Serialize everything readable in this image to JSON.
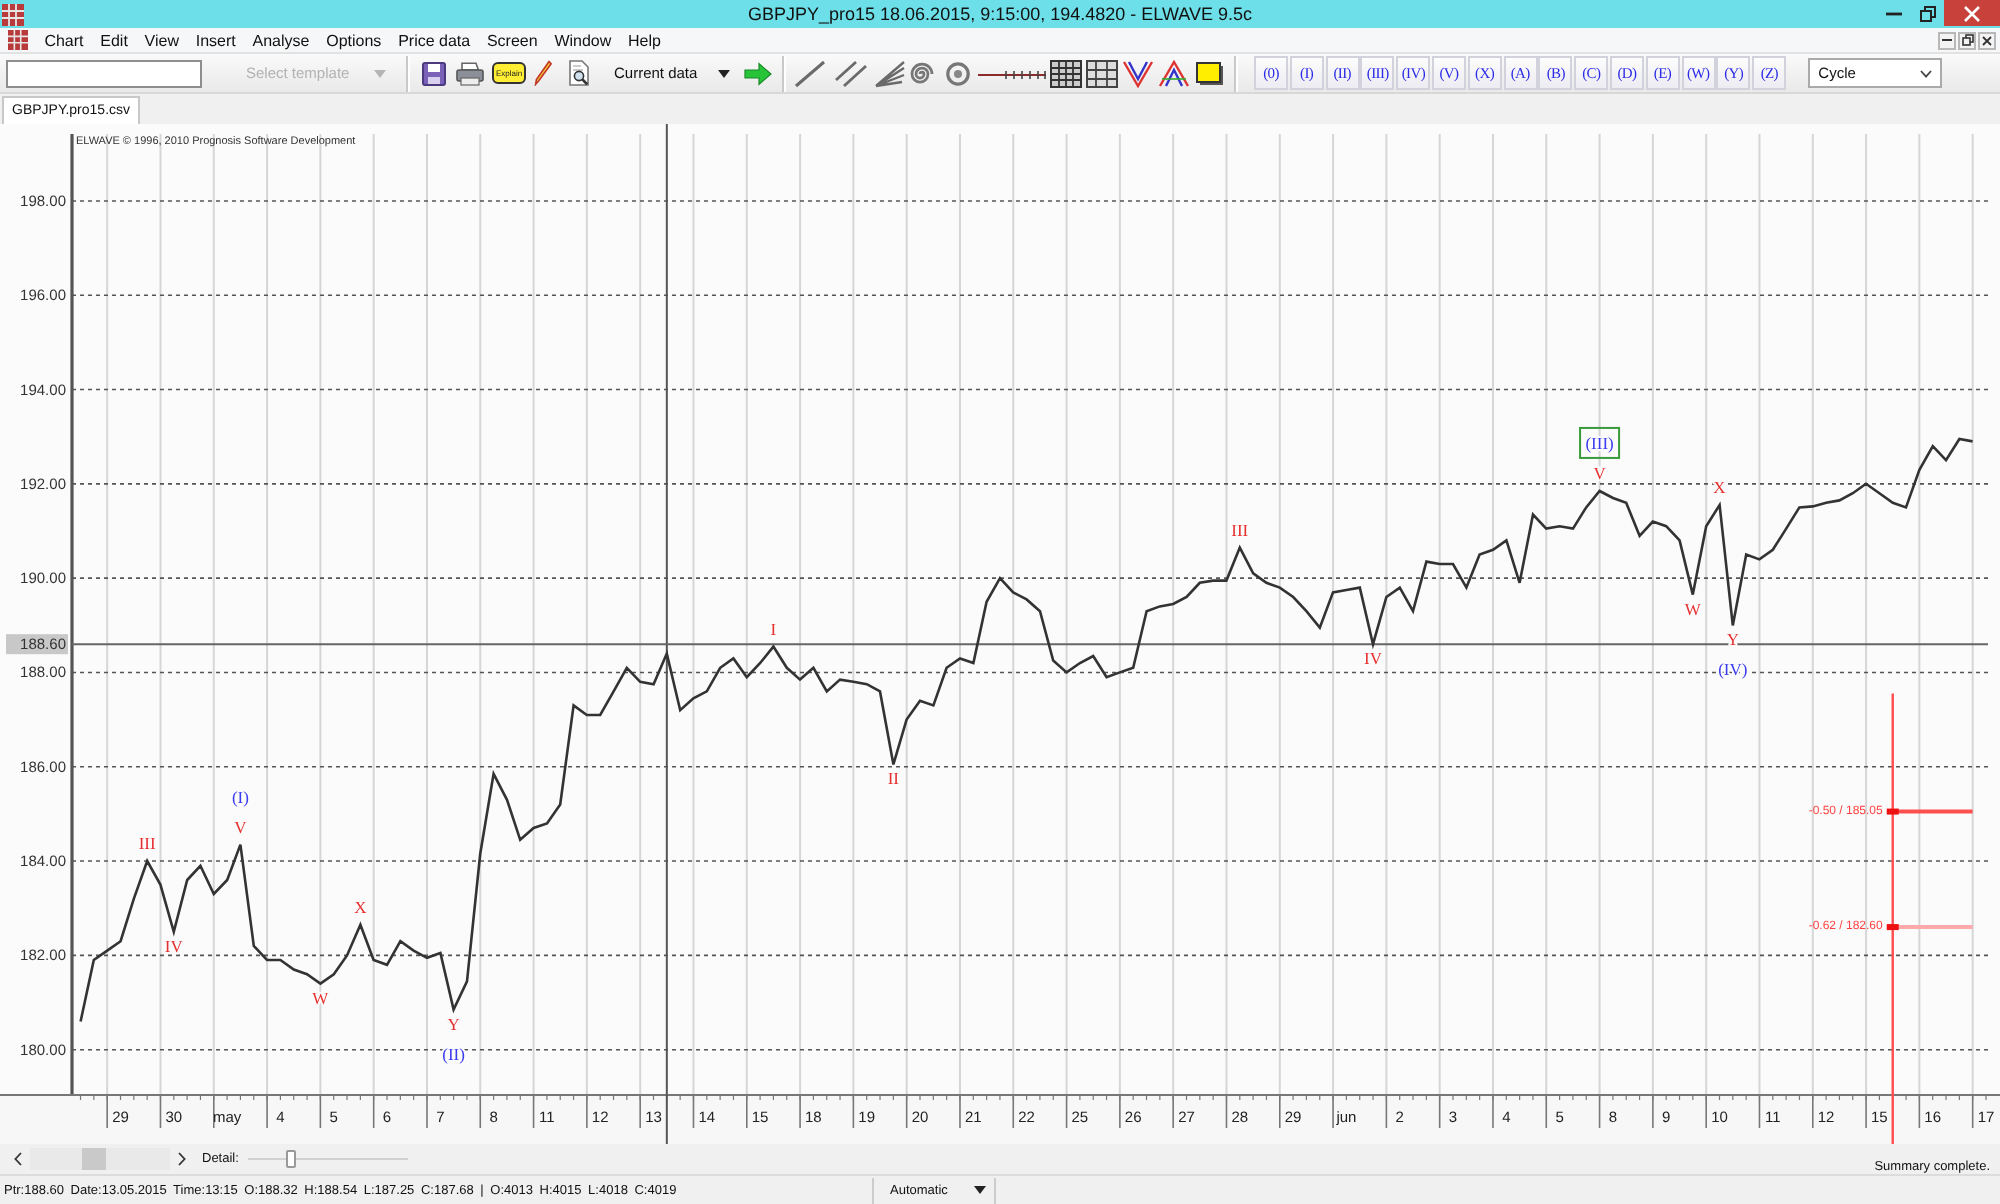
{
  "window": {
    "title": "GBPJPY_pro15 18.06.2015, 9:15:00, 194.4820 - ELWAVE 9.5c"
  },
  "menu": {
    "items": [
      "Chart",
      "Edit",
      "View",
      "Insert",
      "Analyse",
      "Options",
      "Price data",
      "Screen",
      "Window",
      "Help"
    ]
  },
  "toolbar": {
    "template_select": {
      "label": "Select template",
      "disabled": true
    },
    "explain_button": {
      "label": "Explain"
    },
    "data_select": {
      "value": "Current data"
    },
    "wave_buttons": [
      "(0)",
      "(I)",
      "(II)",
      "(III)",
      "(IV)",
      "(V)",
      "(X)",
      "(A)",
      "(B)",
      "(C)",
      "(D)",
      "(E)",
      "(W)",
      "(Y)",
      "(Z)"
    ],
    "degree_select": {
      "value": "Cycle"
    }
  },
  "tabs": [
    {
      "label": "GBPJPY.pro15.csv",
      "selected": true
    }
  ],
  "chart": {
    "copyright": "ELWAVE © 1996, 2010 Prognosis Software Development",
    "chart_data": {
      "type": "line",
      "grid": true,
      "categories": [
        null,
        null,
        null,
        "29",
        null,
        null,
        null,
        "30",
        null,
        null,
        null,
        "may",
        null,
        null,
        null,
        "4",
        null,
        null,
        null,
        "5",
        null,
        null,
        null,
        "6",
        null,
        null,
        null,
        "7",
        null,
        null,
        null,
        "8",
        null,
        null,
        null,
        "11",
        null,
        null,
        null,
        "12",
        null,
        null,
        null,
        "13",
        null,
        null,
        null,
        "14",
        null,
        null,
        null,
        "15",
        null,
        null,
        null,
        "18",
        null,
        null,
        null,
        "19",
        null,
        null,
        null,
        "20",
        null,
        null,
        null,
        "21",
        null,
        null,
        null,
        "22",
        null,
        null,
        null,
        "25",
        null,
        null,
        null,
        "26",
        null,
        null,
        null,
        "27",
        null,
        null,
        null,
        "28",
        null,
        null,
        null,
        "29",
        null,
        null,
        null,
        "jun",
        null,
        null,
        null,
        "2",
        null,
        null,
        null,
        "3",
        null,
        null,
        null,
        "4",
        null,
        null,
        null,
        "5",
        null,
        null,
        null,
        "8",
        null,
        null,
        null,
        "9",
        null,
        null,
        null,
        "10",
        null,
        null,
        null,
        "11",
        null,
        null,
        null,
        "12",
        null,
        null,
        null,
        "15",
        null,
        null,
        null,
        "16",
        null,
        null,
        null,
        "17"
      ],
      "series": [
        {
          "color": "#333333",
          "values": [
            180.6,
            181.9,
            182.1,
            182.3,
            183.2,
            184.0,
            183.5,
            182.5,
            183.6,
            183.9,
            183.3,
            183.6,
            184.35,
            182.2,
            181.9,
            181.9,
            181.7,
            181.6,
            181.4,
            181.6,
            182.0,
            182.65,
            181.9,
            181.8,
            182.3,
            182.1,
            181.95,
            182.05,
            180.85,
            181.45,
            184.15,
            185.85,
            185.3,
            184.45,
            184.7,
            184.8,
            185.2,
            187.3,
            187.1,
            187.1,
            187.6,
            188.1,
            187.8,
            187.75,
            188.4,
            187.2,
            187.45,
            187.6,
            188.1,
            188.3,
            187.9,
            188.2,
            188.55,
            188.1,
            187.85,
            188.1,
            187.6,
            187.85,
            187.8,
            187.75,
            187.6,
            186.05,
            187.0,
            187.4,
            187.3,
            188.1,
            188.3,
            188.2,
            189.5,
            190.0,
            189.7,
            189.55,
            189.3,
            188.25,
            188.0,
            188.2,
            188.35,
            187.9,
            188.0,
            188.1,
            189.3,
            189.4,
            189.45,
            189.6,
            189.9,
            189.95,
            189.95,
            190.65,
            190.1,
            189.9,
            189.8,
            189.6,
            189.3,
            188.95,
            189.7,
            189.75,
            189.8,
            188.6,
            189.6,
            189.8,
            189.3,
            190.35,
            190.3,
            190.3,
            189.8,
            190.5,
            190.6,
            190.8,
            189.9,
            191.35,
            191.05,
            191.1,
            191.05,
            191.5,
            191.85,
            191.7,
            191.6,
            190.9,
            191.2,
            191.1,
            190.8,
            189.65,
            191.1,
            191.55,
            189.0,
            190.5,
            190.4,
            190.6,
            191.05,
            191.5,
            191.52,
            191.6,
            191.65,
            191.8,
            192.0,
            191.8,
            191.6,
            191.5,
            192.3,
            192.8,
            192.5,
            192.95,
            192.9,
            null
          ]
        },
        {
          "name": "-0.50 / 185.05",
          "color": "#ff5050",
          "values": [
            null,
            null,
            null,
            null,
            null,
            null,
            null,
            null,
            null,
            null,
            null,
            null,
            null,
            null,
            null,
            null,
            null,
            null,
            null,
            null,
            null,
            null,
            null,
            null,
            null,
            null,
            null,
            null,
            null,
            null,
            null,
            null,
            null,
            null,
            null,
            null,
            null,
            null,
            null,
            null,
            null,
            null,
            null,
            null,
            null,
            null,
            null,
            null,
            null,
            null,
            null,
            null,
            null,
            null,
            null,
            null,
            null,
            null,
            null,
            null,
            null,
            null,
            null,
            null,
            null,
            null,
            null,
            null,
            null,
            null,
            null,
            null,
            null,
            null,
            null,
            null,
            null,
            null,
            null,
            null,
            null,
            null,
            null,
            null,
            null,
            null,
            null,
            null,
            null,
            null,
            null,
            null,
            null,
            null,
            null,
            null,
            null,
            null,
            null,
            null,
            null,
            null,
            null,
            null,
            null,
            null,
            null,
            null,
            null,
            null,
            null,
            null,
            null,
            null,
            null,
            null,
            null,
            null,
            null,
            null,
            null,
            null,
            null,
            null,
            null,
            null,
            null,
            null,
            null,
            null,
            null,
            null,
            null,
            null,
            null,
            null,
            185.05,
            185.05,
            185.05,
            185.05,
            185.05,
            185.05,
            185.05,
            null
          ]
        },
        {
          "name": "-0.62 / 182.60",
          "color": "#ffaaaa",
          "values": [
            null,
            null,
            null,
            null,
            null,
            null,
            null,
            null,
            null,
            null,
            null,
            null,
            null,
            null,
            null,
            null,
            null,
            null,
            null,
            null,
            null,
            null,
            null,
            null,
            null,
            null,
            null,
            null,
            null,
            null,
            null,
            null,
            null,
            null,
            null,
            null,
            null,
            null,
            null,
            null,
            null,
            null,
            null,
            null,
            null,
            null,
            null,
            null,
            null,
            null,
            null,
            null,
            null,
            null,
            null,
            null,
            null,
            null,
            null,
            null,
            null,
            null,
            null,
            null,
            null,
            null,
            null,
            null,
            null,
            null,
            null,
            null,
            null,
            null,
            null,
            null,
            null,
            null,
            null,
            null,
            null,
            null,
            null,
            null,
            null,
            null,
            null,
            null,
            null,
            null,
            null,
            null,
            null,
            null,
            null,
            null,
            null,
            null,
            null,
            null,
            null,
            null,
            null,
            null,
            null,
            null,
            null,
            null,
            null,
            null,
            null,
            null,
            null,
            null,
            null,
            null,
            null,
            null,
            null,
            null,
            null,
            null,
            null,
            null,
            null,
            null,
            null,
            null,
            null,
            null,
            null,
            null,
            null,
            null,
            null,
            null,
            182.6,
            182.6,
            182.6,
            182.6,
            182.6,
            182.6,
            182.6,
            null
          ]
        }
      ],
      "ylim": [
        179.06,
        199.42
      ],
      "yticks": [
        {
          "value": 180,
          "label": "180.00"
        },
        {
          "value": 182,
          "label": "182.00"
        },
        {
          "value": 184,
          "label": "184.00"
        },
        {
          "value": 186,
          "label": "186.00"
        },
        {
          "value": 188,
          "label": "188.00"
        },
        {
          "value": 190,
          "label": "190.00"
        },
        {
          "value": 192,
          "label": "192.00"
        },
        {
          "value": 194,
          "label": "194.00"
        },
        {
          "value": 196,
          "label": "196.00"
        },
        {
          "value": 198,
          "label": "198.00"
        }
      ],
      "ref_lines": [
        {
          "axis": "y",
          "value": 188.6,
          "label": "188.60"
        }
      ],
      "annotations": [
        {
          "text": "III",
          "y": 184.0
        },
        {
          "text": "IV",
          "y": 182.5
        },
        {
          "text": "V",
          "y": 184.35
        },
        {
          "text": "(I)",
          "y": 184.35
        },
        {
          "text": "W",
          "y": 181.4
        },
        {
          "text": "X",
          "y": 182.65
        },
        {
          "text": "Y",
          "y": 180.85
        },
        {
          "text": "(II)",
          "y": 180.85
        },
        {
          "text": "I",
          "y": 188.55
        },
        {
          "text": "II",
          "y": 186.05
        },
        {
          "text": "III",
          "y": 190.65
        },
        {
          "text": "IV",
          "y": 188.6
        },
        {
          "text": "V",
          "y": 191.85
        },
        {
          "text": "(III)",
          "y": 191.85
        },
        {
          "text": "W",
          "y": 189.65
        },
        {
          "text": "X",
          "y": 191.55
        },
        {
          "text": "Y",
          "y": 189.0
        },
        {
          "text": "(IV)",
          "y": 189.0
        }
      ]
    },
    "wave_labels": [
      {
        "color": "#e53030",
        "boxed": false
      },
      {
        "color": "#e53030",
        "boxed": false
      },
      {
        "color": "#e53030",
        "boxed": false
      },
      {
        "color": "#3b3bf0",
        "boxed": false
      },
      {
        "color": "#e53030",
        "boxed": false
      },
      {
        "color": "#e53030",
        "boxed": false
      },
      {
        "color": "#e53030",
        "boxed": false
      },
      {
        "color": "#3b3bf0",
        "boxed": false
      },
      {
        "color": "#e53030",
        "boxed": false
      },
      {
        "color": "#e53030",
        "boxed": false
      },
      {
        "color": "#e53030",
        "boxed": false
      },
      {
        "color": "#e53030",
        "boxed": false
      },
      {
        "color": "#e53030",
        "boxed": false
      },
      {
        "color": "#3b3bf0",
        "boxed": true
      },
      {
        "color": "#e53030",
        "boxed": false
      },
      {
        "color": "#e53030",
        "boxed": false
      },
      {
        "color": "#e53030",
        "boxed": false
      },
      {
        "color": "#3b3bf0",
        "boxed": false
      }
    ]
  },
  "navigator": {
    "detail": {
      "label": "Detail:",
      "level": 0.26
    },
    "message": "Summary complete."
  },
  "status_bar": {
    "readout": "Ptr:188.60 Date:13.05.2015 Time:13:15 O:188.32 H:188.54 L:187.25 C:187.68 | O:4013 H:4015 L:4018 C:4019",
    "mode_select": {
      "value": "Automatic"
    }
  }
}
